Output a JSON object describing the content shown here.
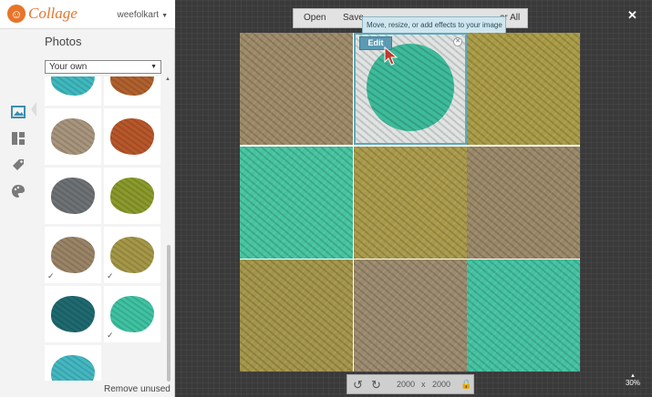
{
  "app": {
    "logo_text": "Collage",
    "user": "weefolkart"
  },
  "panel": {
    "title": "Photos",
    "filter_selected": "Your own",
    "remove_label": "Remove unused",
    "thumbs": [
      {
        "color": "#3fb9bf",
        "checked": false
      },
      {
        "color": "#b0612e",
        "checked": false
      },
      {
        "color": "#a8957d",
        "checked": false
      },
      {
        "color": "#b8572a",
        "checked": false
      },
      {
        "color": "#6e7275",
        "checked": false
      },
      {
        "color": "#8b9a2b",
        "checked": false
      },
      {
        "color": "#9a8466",
        "checked": true
      },
      {
        "color": "#a59747",
        "checked": true
      },
      {
        "color": "#1e6a70",
        "checked": false
      },
      {
        "color": "#3fc3a2",
        "checked": true
      },
      {
        "color": "#44b8c2",
        "checked": false
      }
    ]
  },
  "toolbar": {
    "open_label": "Open",
    "save_label": "Save",
    "clear_label": "ar All"
  },
  "tooltip": "Move, resize, or add effects to your image",
  "edit_label": "Edit",
  "collage": {
    "cells": [
      {
        "color": "#9d8a68"
      },
      {
        "color": "#3dbb9a",
        "selected": true
      },
      {
        "color": "#a99b45"
      },
      {
        "color": "#46c4a0"
      },
      {
        "color": "#a99a4a"
      },
      {
        "color": "#9a8868"
      },
      {
        "color": "#a3954a"
      },
      {
        "color": "#9b8a6e"
      },
      {
        "color": "#44c2a2"
      }
    ]
  },
  "canvas_size": {
    "width": "2000",
    "separator": "x",
    "height": "2000"
  },
  "zoom": "30%",
  "colors": {
    "accent": "#e8742a",
    "edit_button": "#5b9ab3",
    "tooltip_bg": "#cfe6ee"
  }
}
